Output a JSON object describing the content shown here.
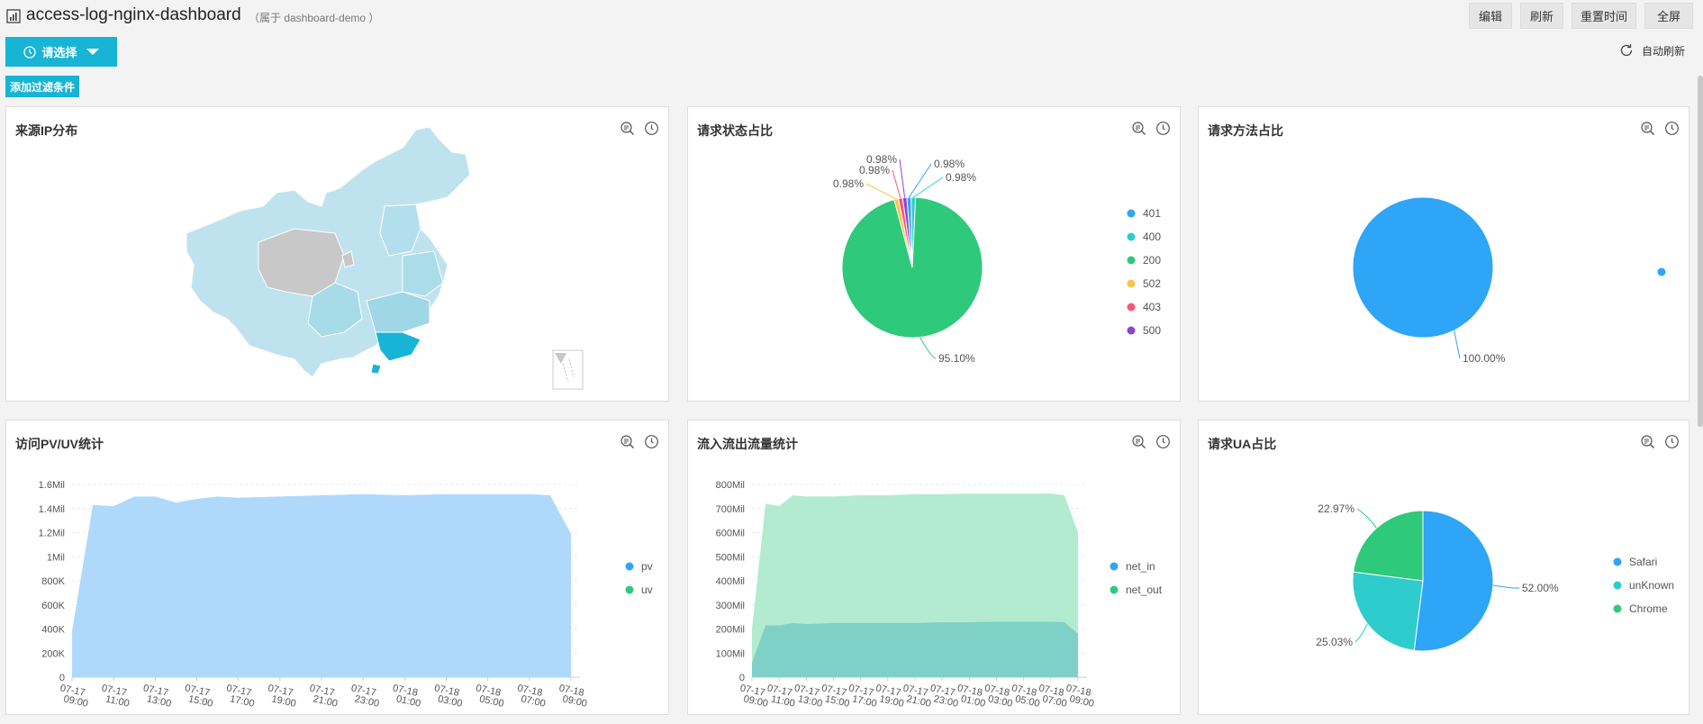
{
  "header": {
    "title": "access-log-nginx-dashboard",
    "subtitle": "（属于 dashboard-demo ）",
    "buttons": {
      "edit": "编辑",
      "refresh": "刷新",
      "reset_time": "重置时间",
      "fullscreen": "全屏"
    }
  },
  "toolbar": {
    "time_select_label": "请选择",
    "auto_refresh_label": "自动刷新",
    "add_filter_label": "添加过滤条件"
  },
  "panels": {
    "ip": {
      "title": "来源IP分布"
    },
    "status": {
      "title": "请求状态占比"
    },
    "method": {
      "title": "请求方法占比"
    },
    "pvuv": {
      "title": "访问PV/UV统计"
    },
    "traffic": {
      "title": "流入流出流量统计"
    },
    "ua": {
      "title": "请求UA占比"
    }
  },
  "icons": {
    "zoom": "zoom-doc-icon",
    "time": "clock-icon",
    "refresh": "refresh-icon",
    "clock": "clock-icon",
    "caret": "caret-down-icon"
  },
  "colors": {
    "accent": "#17b4d5",
    "blue": "#2ea5f7",
    "green": "#2ec97a",
    "teal": "#2ecccc",
    "orange": "#f7c548",
    "red": "#f25a78",
    "purple": "#8e44d6",
    "gray": "#c8c8c8"
  },
  "chart_data": [
    {
      "id": "status",
      "type": "pie",
      "title": "请求状态占比",
      "slices": [
        {
          "label": "401",
          "value": 0.98,
          "color": "#2ea5f7"
        },
        {
          "label": "400",
          "value": 0.98,
          "color": "#2ecccc"
        },
        {
          "label": "200",
          "value": 95.1,
          "color": "#2ec97a"
        },
        {
          "label": "502",
          "value": 0.98,
          "color": "#f7c548"
        },
        {
          "label": "403",
          "value": 0.98,
          "color": "#f25a78"
        },
        {
          "label": "500",
          "value": 0.98,
          "color": "#8e44d6"
        }
      ],
      "data_labels": [
        "0.98%",
        "0.98%",
        "95.10%",
        "0.98%",
        "0.98%",
        "0.98%"
      ],
      "legend": "right"
    },
    {
      "id": "method",
      "type": "pie",
      "title": "请求方法占比",
      "slices": [
        {
          "label": "",
          "value": 100.0,
          "color": "#2ea5f7"
        }
      ],
      "data_labels": [
        "100.00%"
      ],
      "legend": "right"
    },
    {
      "id": "pvuv",
      "type": "area",
      "title": "访问PV/UV统计",
      "x": [
        "07-17 09:00",
        "07-17 11:00",
        "07-17 13:00",
        "07-17 15:00",
        "07-17 17:00",
        "07-17 19:00",
        "07-17 21:00",
        "07-17 23:00",
        "07-18 01:00",
        "07-18 03:00",
        "07-18 05:00",
        "07-18 07:00",
        "07-18 09:00"
      ],
      "y_ticks": [
        "0",
        "200K",
        "400K",
        "600K",
        "800K",
        "1Mil",
        "1.2Mil",
        "1.4Mil",
        "1.6Mil"
      ],
      "ylim": [
        0,
        1600000
      ],
      "series": [
        {
          "name": "pv",
          "color": "#2ea5f7",
          "x": [
            0,
            0.5,
            1,
            1.5,
            2,
            2.5,
            3,
            3.5,
            4,
            5,
            6,
            7,
            8,
            9,
            10,
            11,
            11.5,
            12
          ],
          "values": [
            380000,
            1430000,
            1420000,
            1500000,
            1500000,
            1450000,
            1480000,
            1500000,
            1490000,
            1500000,
            1510000,
            1520000,
            1510000,
            1520000,
            1520000,
            1520000,
            1510000,
            1190000
          ]
        },
        {
          "name": "uv",
          "color": "#2ec97a",
          "x": [
            0,
            12
          ],
          "values": [
            0,
            0
          ]
        }
      ],
      "legend": "right"
    },
    {
      "id": "traffic",
      "type": "area",
      "title": "流入流出流量统计",
      "x": [
        "07-17 09:00",
        "07-17 11:00",
        "07-17 13:00",
        "07-17 15:00",
        "07-17 17:00",
        "07-17 19:00",
        "07-17 21:00",
        "07-17 23:00",
        "07-18 01:00",
        "07-18 03:00",
        "07-18 05:00",
        "07-18 07:00",
        "07-18 09:00"
      ],
      "y_ticks": [
        "0",
        "100Mil",
        "200Mil",
        "300Mil",
        "400Mil",
        "500Mil",
        "600Mil",
        "700Mil",
        "800Mil"
      ],
      "ylim": [
        0,
        800000000
      ],
      "series": [
        {
          "name": "net_in",
          "color": "#2ea5f7",
          "x": [
            0,
            0.5,
            1,
            1.5,
            2,
            3,
            4,
            5,
            6,
            7,
            8,
            9,
            10,
            11,
            11.5,
            12
          ],
          "values": [
            60000000,
            215000000,
            215000000,
            225000000,
            220000000,
            225000000,
            225000000,
            225000000,
            225000000,
            228000000,
            228000000,
            230000000,
            230000000,
            230000000,
            228000000,
            180000000
          ]
        },
        {
          "name": "net_out",
          "color": "#2ec97a",
          "x": [
            0,
            0.5,
            1,
            1.5,
            2,
            3,
            4,
            5,
            6,
            7,
            8,
            9,
            10,
            11,
            11.5,
            12
          ],
          "values": [
            200000000,
            720000000,
            710000000,
            755000000,
            750000000,
            750000000,
            755000000,
            755000000,
            760000000,
            760000000,
            762000000,
            762000000,
            762000000,
            762000000,
            755000000,
            600000000
          ]
        }
      ],
      "legend": "right"
    },
    {
      "id": "ua",
      "type": "pie",
      "title": "请求UA占比",
      "slices": [
        {
          "label": "Safari",
          "value": 52.0,
          "color": "#2ea5f7"
        },
        {
          "label": "unKnown",
          "value": 25.03,
          "color": "#2ecccc"
        },
        {
          "label": "Chrome",
          "value": 22.97,
          "color": "#2ec97a"
        }
      ],
      "data_labels": [
        "52.00%",
        "25.03%",
        "22.97%"
      ],
      "legend": "right"
    }
  ]
}
